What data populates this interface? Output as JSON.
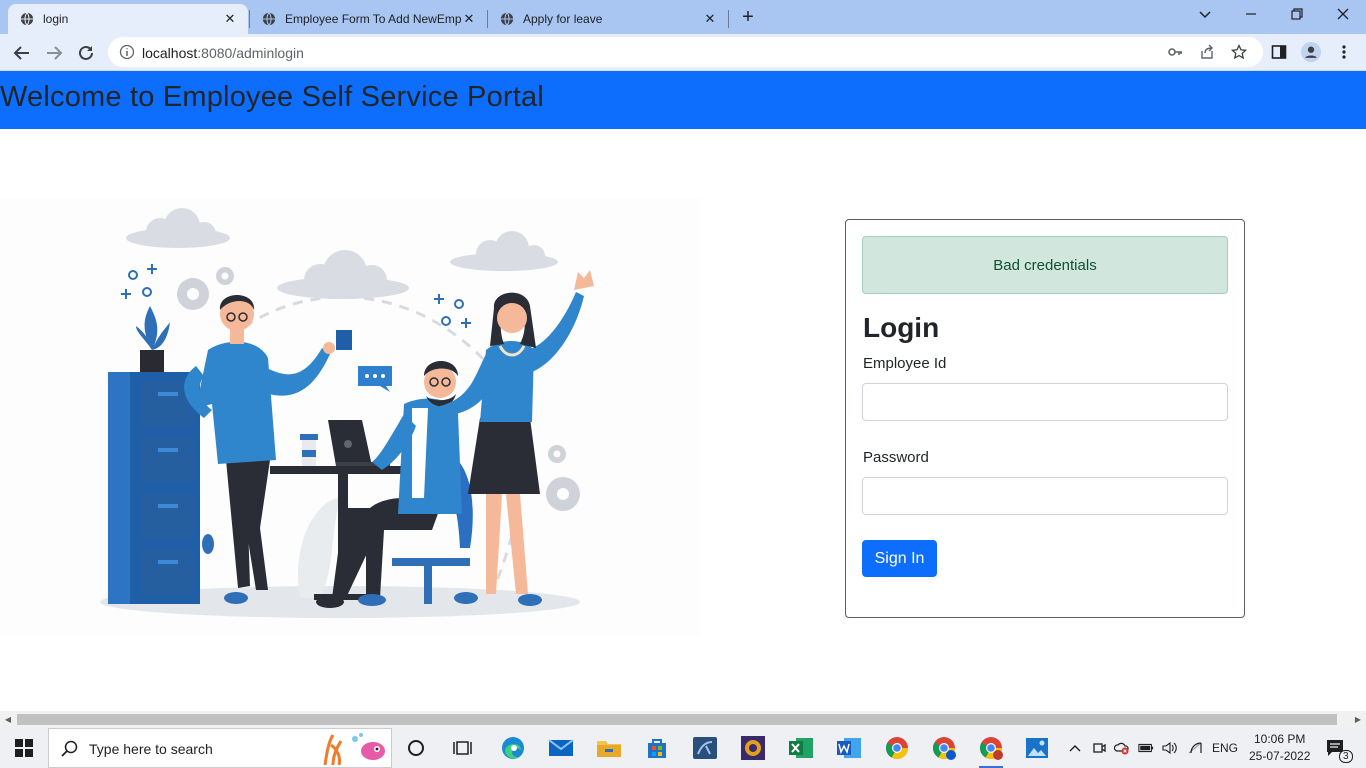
{
  "browser": {
    "tabs": [
      {
        "title": "login",
        "active": true
      },
      {
        "title": "Employee Form To Add NewEmp",
        "active": false
      },
      {
        "title": "Apply for leave",
        "active": false
      }
    ],
    "url_host": "localhost",
    "url_path": ":8080/adminlogin"
  },
  "header": {
    "title": "Welcome to Employee Self Service Portal",
    "background": "#0d6efd"
  },
  "login": {
    "alert": "Bad credentials",
    "heading": "Login",
    "employee_id_label": "Employee Id",
    "employee_id_value": "",
    "password_label": "Password",
    "password_value": "",
    "submit_label": "Sign In"
  },
  "taskbar": {
    "search_placeholder": "Type here to search",
    "language": "ENG",
    "time": "10:06 PM",
    "date": "25-07-2022",
    "notification_count": "3"
  },
  "colors": {
    "primary": "#0d6efd",
    "alert_bg": "#d1e7dd",
    "alert_text": "#0f5132"
  }
}
